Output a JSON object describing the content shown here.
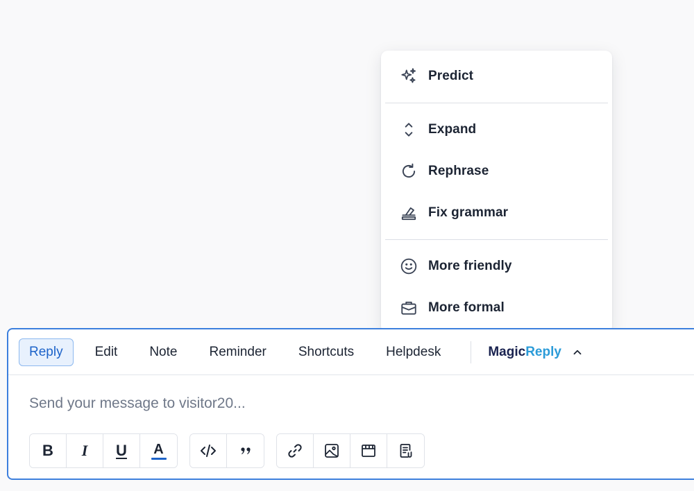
{
  "magic_menu": {
    "items": [
      {
        "label": "Predict",
        "icon": "sparkles-icon"
      },
      {
        "label": "Expand",
        "icon": "expand-icon"
      },
      {
        "label": "Rephrase",
        "icon": "refresh-icon"
      },
      {
        "label": "Fix grammar",
        "icon": "eraser-icon"
      },
      {
        "label": "More friendly",
        "icon": "smile-icon"
      },
      {
        "label": "More formal",
        "icon": "briefcase-icon"
      }
    ]
  },
  "composer": {
    "tabs": [
      {
        "label": "Reply",
        "active": true
      },
      {
        "label": "Edit"
      },
      {
        "label": "Note"
      },
      {
        "label": "Reminder"
      },
      {
        "label": "Shortcuts"
      },
      {
        "label": "Helpdesk"
      }
    ],
    "magicreply": {
      "part1": "Magic",
      "part2": "Reply"
    },
    "input": {
      "placeholder": "Send your message to visitor20...",
      "value": ""
    },
    "toolbar": {
      "bold": "B",
      "italic": "I",
      "underline": "U",
      "text_color": "A",
      "text_color_swatch": "#1d63c9"
    }
  },
  "colors": {
    "accent": "#3c7fdd",
    "active_tab_bg": "#e8f1fd",
    "magic": "#1a2350",
    "reply": "#2b9bd8"
  }
}
